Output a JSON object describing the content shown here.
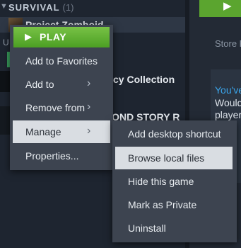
{
  "library": {
    "category": {
      "name": "SURVIVAL",
      "count": "(1)"
    },
    "selected_game": "Project Zomboid",
    "background_texts": [
      "U",
      "cy Collection",
      "COND STORY R"
    ]
  },
  "right_panel": {
    "play_icon": "P",
    "store_link": "Store P",
    "promo_lines": [
      "You've",
      "Would",
      "player"
    ]
  },
  "context_menu": {
    "play_label": "PLAY",
    "items": [
      {
        "label": "Add to Favorites",
        "has_submenu": false
      },
      {
        "label": "Add to",
        "has_submenu": true
      },
      {
        "label": "Remove from",
        "has_submenu": true
      },
      {
        "label": "Manage",
        "has_submenu": true
      },
      {
        "label": "Properties...",
        "has_submenu": false
      }
    ]
  },
  "manage_submenu": {
    "items": [
      {
        "label": "Add desktop shortcut"
      },
      {
        "label": "Browse local files"
      },
      {
        "label": "Hide this game"
      },
      {
        "label": "Mark as Private"
      },
      {
        "label": "Uninstall"
      }
    ]
  },
  "colors": {
    "accent_green": "#5ba52f",
    "highlight": "#d9dde2",
    "menu_bg": "#3d4450"
  }
}
